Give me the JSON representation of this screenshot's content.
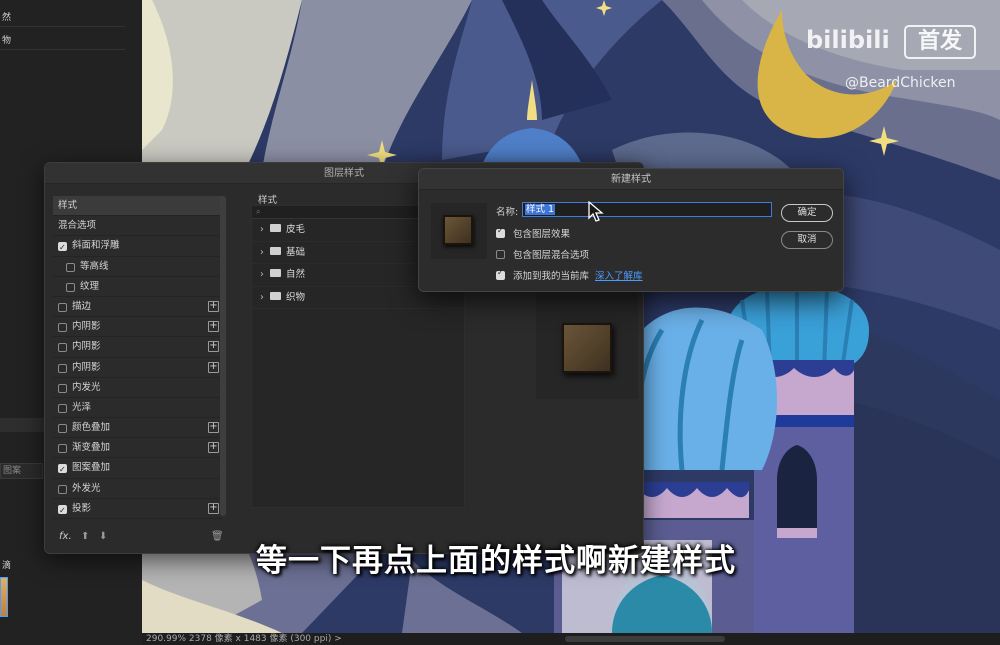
{
  "left_panel": {
    "rows": [
      "然",
      "物"
    ],
    "search_placeholder": "图案",
    "bottom_label": "滴"
  },
  "status_bar": {
    "text": "290.99%   2378 像素 x 1483 像素 (300 ppi)   >"
  },
  "layer_style_dialog": {
    "title": "图层样式",
    "sidebar": [
      {
        "label": "样式",
        "kind": "header"
      },
      {
        "label": "混合选项",
        "kind": "plain"
      },
      {
        "label": "斜面和浮雕",
        "checked": true,
        "indent": 0,
        "plus": false
      },
      {
        "label": "等高线",
        "checked": false,
        "indent": 1,
        "plus": false
      },
      {
        "label": "纹理",
        "checked": false,
        "indent": 1,
        "plus": false
      },
      {
        "label": "描边",
        "checked": false,
        "indent": 0,
        "plus": true
      },
      {
        "label": "内阴影",
        "checked": false,
        "indent": 0,
        "plus": true
      },
      {
        "label": "内阴影",
        "checked": false,
        "indent": 0,
        "plus": true
      },
      {
        "label": "内阴影",
        "checked": false,
        "indent": 0,
        "plus": true
      },
      {
        "label": "内发光",
        "checked": false,
        "indent": 0,
        "plus": false
      },
      {
        "label": "光泽",
        "checked": false,
        "indent": 0,
        "plus": false
      },
      {
        "label": "颜色叠加",
        "checked": false,
        "indent": 0,
        "plus": true
      },
      {
        "label": "渐变叠加",
        "checked": false,
        "indent": 0,
        "plus": true
      },
      {
        "label": "图案叠加",
        "checked": true,
        "indent": 0,
        "plus": false
      },
      {
        "label": "外发光",
        "checked": false,
        "indent": 0,
        "plus": false
      },
      {
        "label": "投影",
        "checked": true,
        "indent": 0,
        "plus": true
      }
    ],
    "footer_fx": "fx.",
    "styles_label": "样式",
    "style_folders": [
      "皮毛",
      "基础",
      "自然",
      "织物"
    ]
  },
  "new_style_dialog": {
    "title": "新建样式",
    "name_label": "名称:",
    "name_value": "样式 1",
    "options": [
      {
        "label": "包含图层效果",
        "checked": true
      },
      {
        "label": "包含图层混合选项",
        "checked": false
      },
      {
        "label": "添加到我的当前库",
        "checked": true
      }
    ],
    "learn_more": "深入了解库",
    "ok_label": "确定",
    "cancel_label": "取消"
  },
  "watermark": {
    "logo": "bilibili",
    "badge": "首发",
    "user": "@BeardChicken"
  },
  "subtitle": "等一下再点上面的样式啊新建样式",
  "colors": {
    "accent_blue": "#3d74d6",
    "link_blue": "#4d9bff",
    "dialog_bg": "#2b2b2b",
    "moon_gold": "#d9b547"
  }
}
